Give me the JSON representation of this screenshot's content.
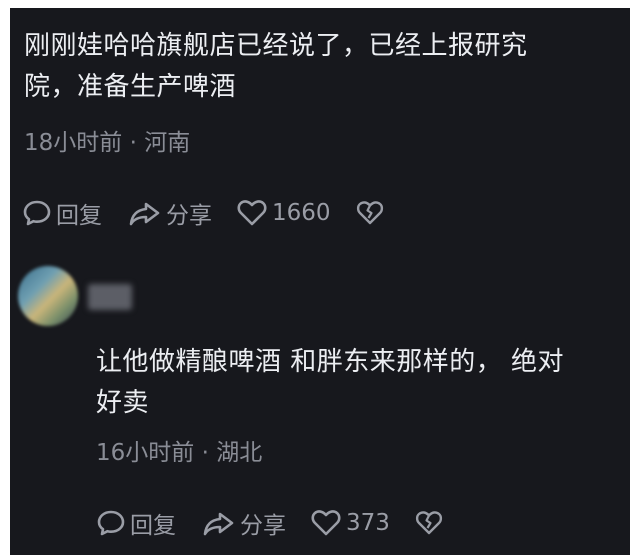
{
  "comment1": {
    "text_line1": "刚刚娃哈哈旗舰店已经说了，已经上报研究",
    "text_line2": "院，准备生产啤酒",
    "meta": "18小时前 · 河南",
    "reply_label": "回复",
    "share_label": "分享",
    "like_count": "1660"
  },
  "comment2": {
    "text_line1": "让他做精酿啤酒 和胖东来那样的， 绝对",
    "text_line2": "好卖",
    "meta": "16小时前 · 湖北",
    "reply_label": "回复",
    "share_label": "分享",
    "like_count": "373"
  },
  "icons": {
    "reply": "comment-bubble-icon",
    "share": "share-arrow-icon",
    "like": "heart-icon",
    "dislike": "broken-heart-icon"
  },
  "colors": {
    "background": "#17181d",
    "text": "#eceef2",
    "meta": "#8a8d96"
  }
}
